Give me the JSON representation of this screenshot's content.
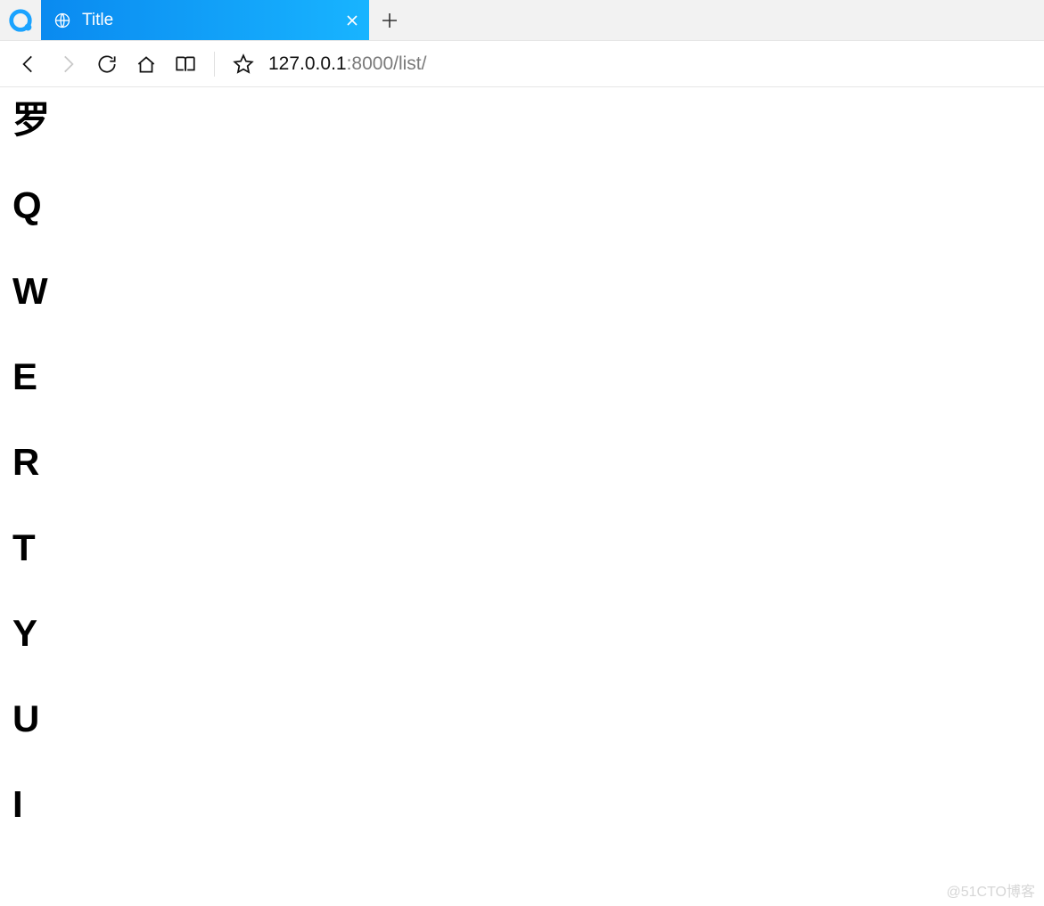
{
  "browser": {
    "tab_title": "Title",
    "address": {
      "host": "127.0.0.1",
      "rest": ":8000/list/"
    }
  },
  "page": {
    "items": [
      "罗",
      "Q",
      "W",
      "E",
      "R",
      "T",
      "Y",
      "U",
      "I"
    ]
  },
  "watermark": "@51CTO博客"
}
